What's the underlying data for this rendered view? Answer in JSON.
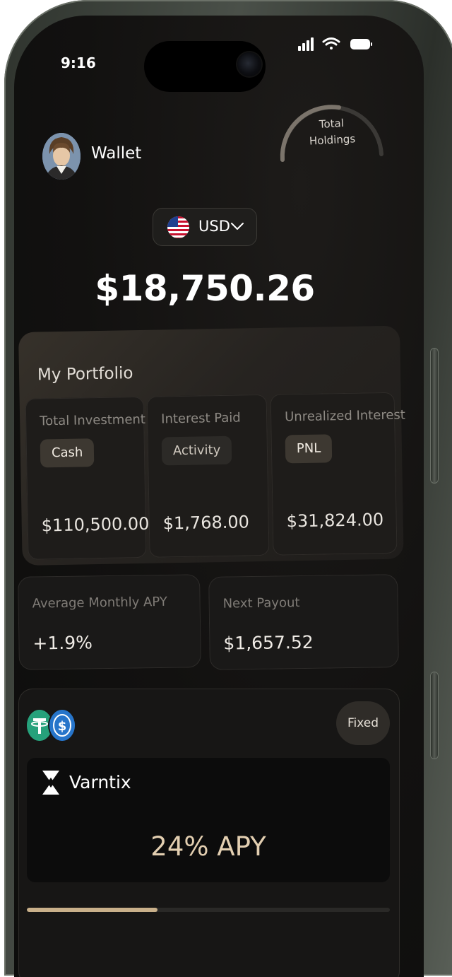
{
  "status_bar": {
    "time": "9:16"
  },
  "header": {
    "title": "Wallet",
    "gauge_label_line1": "Total",
    "gauge_label_line2": "Holdings"
  },
  "currency": {
    "code": "USD",
    "icon": "us-flag-icon"
  },
  "balance": "$18,750.26",
  "portfolio": {
    "title": "My Portfolio",
    "cards": [
      {
        "label": "Total Investment",
        "chip": "Cash",
        "value": "$110,500.00"
      },
      {
        "label": "Interest Paid",
        "chip": "Activity",
        "value": "$1,768.00"
      },
      {
        "label": "Unrealized Interest",
        "chip": "PNL",
        "value": "$31,824.00"
      }
    ]
  },
  "stats": {
    "apy": {
      "label": "Average Monthly APY",
      "value": "+1.9%"
    },
    "payout": {
      "label": "Next Payout",
      "value": "$1,657.52"
    }
  },
  "product": {
    "coins": [
      "usdt-icon",
      "usdc-icon"
    ],
    "tag": "Fixed",
    "brand": "Varntix",
    "apy": "24% APY",
    "progress": 0.36
  },
  "colors": {
    "accent": "#c9b08a",
    "apy_text": "#e3cfb1",
    "background": "#121110"
  }
}
